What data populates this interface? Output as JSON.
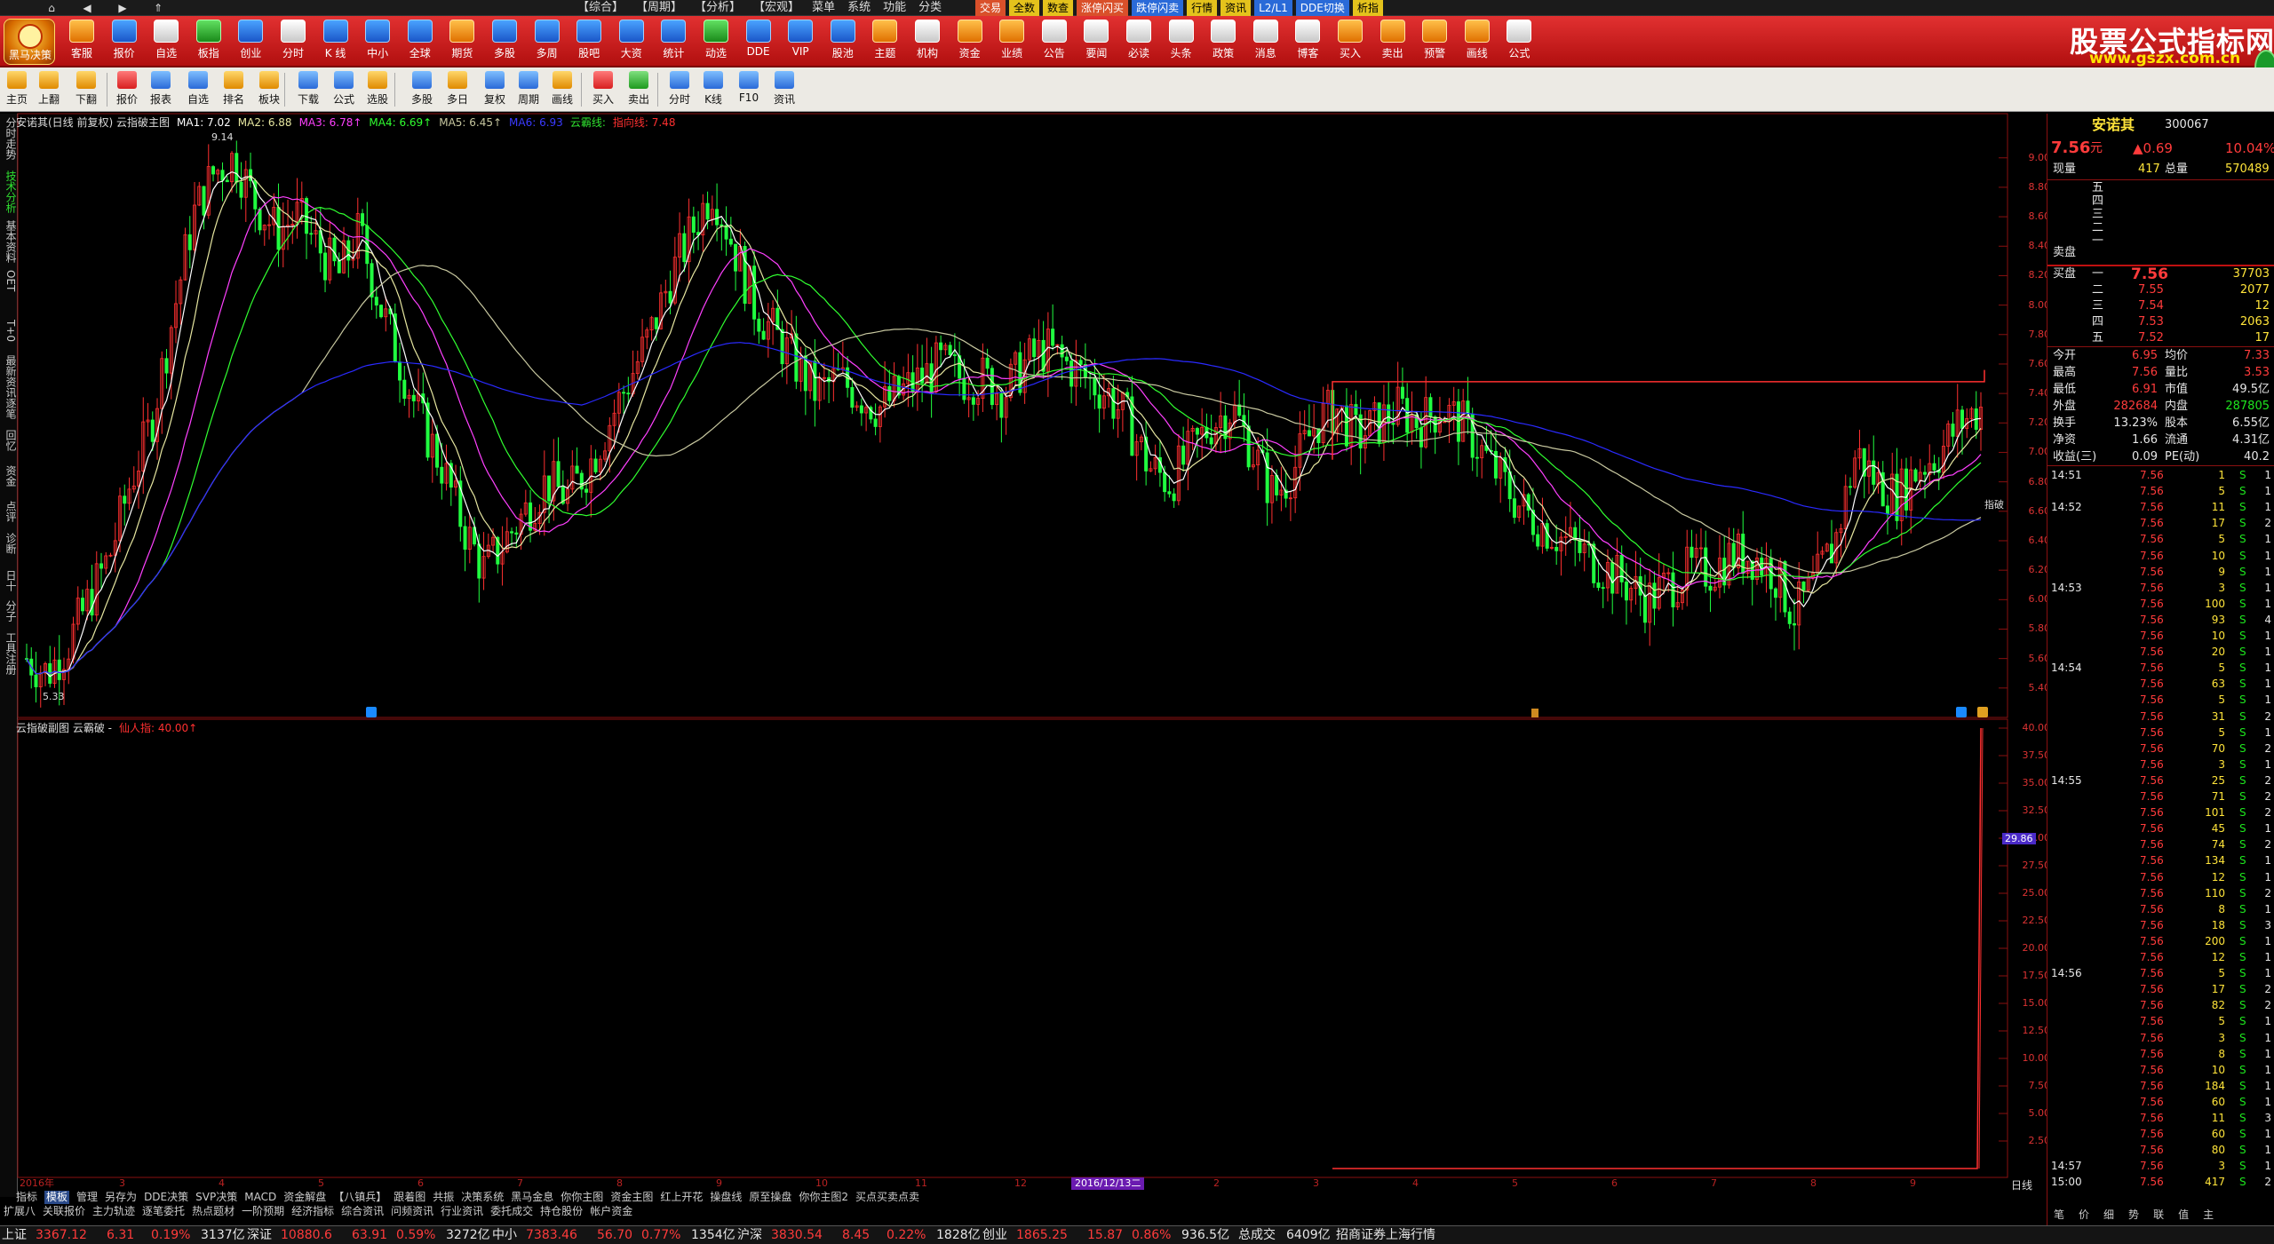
{
  "menubar": {
    "nav": [
      "⌂",
      "◀",
      "▶",
      "⇑"
    ],
    "items": [
      "【综合】",
      "【周期】",
      "【分析】",
      "【宏观】",
      "菜单",
      "系统",
      "功能",
      "分类"
    ],
    "highlight": [
      {
        "label": "交易",
        "bg": "#d9502a",
        "fg": "#ffffff"
      },
      {
        "label": "全数",
        "bg": "#e4c21c",
        "fg": "#000000"
      },
      {
        "label": "数查",
        "bg": "#e4c21c",
        "fg": "#000000"
      },
      {
        "label": "涨停闪买",
        "bg": "#d9502a",
        "fg": "#ffffff"
      },
      {
        "label": "跌停闪卖",
        "bg": "#2a6ad8",
        "fg": "#ffffff"
      },
      {
        "label": "行情",
        "bg": "#e4c21c",
        "fg": "#000000"
      },
      {
        "label": "资讯",
        "bg": "#e4c21c",
        "fg": "#000000"
      },
      {
        "label": "L2/L1",
        "bg": "#2a6ad8",
        "fg": "#ffffff"
      },
      {
        "label": "DDE切换",
        "bg": "#2a6ad8",
        "fg": "#ffffff"
      },
      {
        "label": "析指",
        "bg": "#e4c21c",
        "fg": "#000000"
      }
    ]
  },
  "toolbar1": {
    "logo_label": "黑马决策",
    "items": [
      "客服",
      "报价",
      "自选",
      "板指",
      "创业",
      "分时",
      "K 线",
      "中小",
      "全球",
      "期货",
      "多股",
      "多周",
      "股吧",
      "大资",
      "统计",
      "动选",
      "DDE",
      "VIP",
      "股池",
      "主题",
      "机构",
      "资金",
      "业绩",
      "公告",
      "要闻",
      "必读",
      "头条",
      "政策",
      "消息",
      "博客",
      "买入",
      "卖出",
      "预警",
      "画线",
      "公式"
    ],
    "brand_title": "股票公式指标网",
    "brand_url": "www.gszx.com.cn"
  },
  "toolbar2": {
    "items": [
      "主页",
      "上翻",
      "下翻",
      "报价",
      "报表",
      "自选",
      "排名",
      "板块",
      "下载",
      "公式",
      "选股",
      "多股",
      "多日",
      "复权",
      "周期",
      "画线",
      "买入",
      "卖出",
      "分时",
      "K线",
      "F10",
      "资讯"
    ]
  },
  "left_tabs": [
    "分时走势",
    "技术分析",
    "基本资料",
    "OET",
    "T+0",
    "最新资讯",
    "逐笔",
    "回忆",
    "资金",
    "点评",
    "诊断",
    "日十",
    "分子",
    "工具注册"
  ],
  "chart": {
    "legend_main": [
      {
        "t": "安诺其(日线 前复权) 云指破主图",
        "c": "#dddddd"
      },
      {
        "t": "MA1: 7.02",
        "c": "#ffffff"
      },
      {
        "t": "MA2: 6.88",
        "c": "#e6e6a0"
      },
      {
        "t": "MA3: 6.78↑",
        "c": "#ff40ff"
      },
      {
        "t": "MA4: 6.69↑",
        "c": "#30ff30"
      },
      {
        "t": "MA5: 6.45↑",
        "c": "#c8c8a0"
      },
      {
        "t": "MA6: 6.93",
        "c": "#3a3aff"
      },
      {
        "t": "云霸线:",
        "c": "#30e030"
      },
      {
        "t": "指向线: 7.48",
        "c": "#ff3030"
      }
    ],
    "legend_sub": [
      {
        "t": "云指破副图 云霸破 -",
        "c": "#dddddd"
      },
      {
        "t": "仙人指: 40.00↑",
        "c": "#ff3030"
      }
    ],
    "annot_high": "9.14",
    "annot_low": "5.33",
    "annot_zhipo": "指破",
    "sub_marker": "29.86",
    "date_labels": [
      "2016年",
      "3",
      "4",
      "5",
      "6",
      "7",
      "8",
      "9",
      "10",
      "11",
      "12",
      "2016/12/13二",
      "2",
      "3",
      "4",
      "5",
      "6",
      "7",
      "8",
      "9"
    ],
    "date_hl": "2016/12/13二",
    "colors": {
      "up": "#ff3030",
      "down": "#20ff40",
      "ma1": "#ffffff",
      "ma2": "#e6e6a0",
      "ma3": "#ff40ff",
      "ma4": "#30ff30",
      "ma5": "#c8c8a0",
      "ma6": "#2a2aff",
      "grid": "#3a0a0a"
    }
  },
  "chart_data": {
    "type": "candlestick",
    "title": "安诺其(日线 前复权)",
    "ylim_main": [
      5.2,
      9.3
    ],
    "yticks_main": [
      "9.00",
      "8.80",
      "8.60",
      "8.40",
      "8.20",
      "8.00",
      "7.80",
      "7.60",
      "7.40",
      "7.20",
      "7.00",
      "6.80",
      "6.60",
      "6.40",
      "6.20",
      "6.00",
      "5.80",
      "5.60",
      "5.40"
    ],
    "ylim_sub": [
      0,
      40
    ],
    "yticks_sub": [
      "40.00",
      "37.50",
      "35.00",
      "32.50",
      "30.00",
      "27.50",
      "25.00",
      "22.50",
      "20.00",
      "17.50",
      "15.00",
      "12.50",
      "10.00",
      "7.50",
      "5.00",
      "2.50"
    ],
    "price_path": [
      5.6,
      5.5,
      5.7,
      6.0,
      6.3,
      6.8,
      7.2,
      7.9,
      8.6,
      8.9,
      9.0,
      8.7,
      8.5,
      8.6,
      8.4,
      8.2,
      8.5,
      8.0,
      7.6,
      7.2,
      6.9,
      6.5,
      6.2,
      6.4,
      6.6,
      6.8,
      6.7,
      6.9,
      7.2,
      7.5,
      7.8,
      8.2,
      8.5,
      8.8,
      8.4,
      8.0,
      7.8,
      7.6,
      7.4,
      7.5,
      7.4,
      7.3,
      7.4,
      7.5,
      7.6,
      7.5,
      7.5,
      7.4,
      7.6,
      7.7,
      7.6,
      7.5,
      7.4,
      7.2,
      6.9,
      6.8,
      7.0,
      7.2,
      7.3,
      7.0,
      6.7,
      6.9,
      7.2,
      7.3,
      7.1,
      7.2,
      7.3,
      7.2,
      7.3,
      7.2,
      7.0,
      6.8,
      6.6,
      6.5,
      6.4,
      6.3,
      6.2,
      6.1,
      6.0,
      6.1,
      6.2,
      6.2,
      6.3,
      6.3,
      6.2,
      5.9,
      6.1,
      6.4,
      7.0,
      6.8,
      6.7,
      6.9,
      7.0,
      7.2,
      7.3
    ]
  },
  "quote": {
    "name": "安诺其",
    "code": "300067",
    "price": "7.56",
    "price_unit": "元",
    "change": "▲0.69",
    "pct": "10.04%",
    "xianliang_l": "现量",
    "xianliang_v": "417",
    "zongliang_l": "总量",
    "zongliang_v": "570489",
    "ask_levels": [
      "五",
      "四",
      "三",
      "二",
      "一"
    ],
    "ask_label": "卖盘",
    "bid_label": "买盘",
    "bids": [
      {
        "lvl": "一",
        "p": "7.56",
        "v": "37703"
      },
      {
        "lvl": "二",
        "p": "7.55",
        "v": "2077"
      },
      {
        "lvl": "三",
        "p": "7.54",
        "v": "12"
      },
      {
        "lvl": "四",
        "p": "7.53",
        "v": "2063"
      },
      {
        "lvl": "五",
        "p": "7.52",
        "v": "17"
      }
    ],
    "stats": [
      {
        "l1": "今开",
        "v1": "6.95",
        "c1": "red",
        "l2": "均价",
        "v2": "7.33",
        "c2": "red"
      },
      {
        "l1": "最高",
        "v1": "7.56",
        "c1": "red",
        "l2": "量比",
        "v2": "3.53",
        "c2": "red"
      },
      {
        "l1": "最低",
        "v1": "6.91",
        "c1": "red",
        "l2": "市值",
        "v2": "49.5亿",
        "c2": "wht"
      },
      {
        "l1": "外盘",
        "v1": "282684",
        "c1": "red",
        "l2": "内盘",
        "v2": "287805",
        "c2": "grn"
      },
      {
        "l1": "换手",
        "v1": "13.23%",
        "c1": "wht",
        "l2": "股本",
        "v2": "6.55亿",
        "c2": "wht"
      },
      {
        "l1": "净资",
        "v1": "1.66",
        "c1": "wht",
        "l2": "流通",
        "v2": "4.31亿",
        "c2": "wht"
      },
      {
        "l1": "收益(三)",
        "v1": "0.09",
        "c1": "wht",
        "l2": "PE(动)",
        "v2": "40.2",
        "c2": "wht"
      }
    ]
  },
  "trades": [
    {
      "t": "14:51",
      "p": "7.56",
      "v": "1",
      "bs": "S",
      "n": "1"
    },
    {
      "t": "",
      "p": "7.56",
      "v": "5",
      "bs": "S",
      "n": "1"
    },
    {
      "t": "14:52",
      "p": "7.56",
      "v": "11",
      "bs": "S",
      "n": "1"
    },
    {
      "t": "",
      "p": "7.56",
      "v": "17",
      "bs": "S",
      "n": "2"
    },
    {
      "t": "",
      "p": "7.56",
      "v": "5",
      "bs": "S",
      "n": "1"
    },
    {
      "t": "",
      "p": "7.56",
      "v": "10",
      "bs": "S",
      "n": "1"
    },
    {
      "t": "",
      "p": "7.56",
      "v": "9",
      "bs": "S",
      "n": "1"
    },
    {
      "t": "14:53",
      "p": "7.56",
      "v": "3",
      "bs": "S",
      "n": "1"
    },
    {
      "t": "",
      "p": "7.56",
      "v": "100",
      "bs": "S",
      "n": "1"
    },
    {
      "t": "",
      "p": "7.56",
      "v": "93",
      "bs": "S",
      "n": "4"
    },
    {
      "t": "",
      "p": "7.56",
      "v": "10",
      "bs": "S",
      "n": "1"
    },
    {
      "t": "",
      "p": "7.56",
      "v": "20",
      "bs": "S",
      "n": "1"
    },
    {
      "t": "14:54",
      "p": "7.56",
      "v": "5",
      "bs": "S",
      "n": "1"
    },
    {
      "t": "",
      "p": "7.56",
      "v": "63",
      "bs": "S",
      "n": "1"
    },
    {
      "t": "",
      "p": "7.56",
      "v": "5",
      "bs": "S",
      "n": "1"
    },
    {
      "t": "",
      "p": "7.56",
      "v": "31",
      "bs": "S",
      "n": "2"
    },
    {
      "t": "",
      "p": "7.56",
      "v": "5",
      "bs": "S",
      "n": "1"
    },
    {
      "t": "",
      "p": "7.56",
      "v": "70",
      "bs": "S",
      "n": "2"
    },
    {
      "t": "",
      "p": "7.56",
      "v": "3",
      "bs": "S",
      "n": "1"
    },
    {
      "t": "14:55",
      "p": "7.56",
      "v": "25",
      "bs": "S",
      "n": "2"
    },
    {
      "t": "",
      "p": "7.56",
      "v": "71",
      "bs": "S",
      "n": "2"
    },
    {
      "t": "",
      "p": "7.56",
      "v": "101",
      "bs": "S",
      "n": "2"
    },
    {
      "t": "",
      "p": "7.56",
      "v": "45",
      "bs": "S",
      "n": "1"
    },
    {
      "t": "",
      "p": "7.56",
      "v": "74",
      "bs": "S",
      "n": "2"
    },
    {
      "t": "",
      "p": "7.56",
      "v": "134",
      "bs": "S",
      "n": "1"
    },
    {
      "t": "",
      "p": "7.56",
      "v": "12",
      "bs": "S",
      "n": "1"
    },
    {
      "t": "",
      "p": "7.56",
      "v": "110",
      "bs": "S",
      "n": "2"
    },
    {
      "t": "",
      "p": "7.56",
      "v": "8",
      "bs": "S",
      "n": "1"
    },
    {
      "t": "",
      "p": "7.56",
      "v": "18",
      "bs": "S",
      "n": "3"
    },
    {
      "t": "",
      "p": "7.56",
      "v": "200",
      "bs": "S",
      "n": "1"
    },
    {
      "t": "",
      "p": "7.56",
      "v": "12",
      "bs": "S",
      "n": "1"
    },
    {
      "t": "14:56",
      "p": "7.56",
      "v": "5",
      "bs": "S",
      "n": "1"
    },
    {
      "t": "",
      "p": "7.56",
      "v": "17",
      "bs": "S",
      "n": "2"
    },
    {
      "t": "",
      "p": "7.56",
      "v": "82",
      "bs": "S",
      "n": "2"
    },
    {
      "t": "",
      "p": "7.56",
      "v": "5",
      "bs": "S",
      "n": "1"
    },
    {
      "t": "",
      "p": "7.56",
      "v": "3",
      "bs": "S",
      "n": "1"
    },
    {
      "t": "",
      "p": "7.56",
      "v": "8",
      "bs": "S",
      "n": "1"
    },
    {
      "t": "",
      "p": "7.56",
      "v": "10",
      "bs": "S",
      "n": "1"
    },
    {
      "t": "",
      "p": "7.56",
      "v": "184",
      "bs": "S",
      "n": "1"
    },
    {
      "t": "",
      "p": "7.56",
      "v": "60",
      "bs": "S",
      "n": "1"
    },
    {
      "t": "",
      "p": "7.56",
      "v": "11",
      "bs": "S",
      "n": "3"
    },
    {
      "t": "",
      "p": "7.56",
      "v": "60",
      "bs": "S",
      "n": "1"
    },
    {
      "t": "",
      "p": "7.56",
      "v": "80",
      "bs": "S",
      "n": "1"
    },
    {
      "t": "14:57",
      "p": "7.56",
      "v": "3",
      "bs": "S",
      "n": "1"
    },
    {
      "t": "15:00",
      "p": "7.56",
      "v": "417",
      "bs": "S",
      "n": "2"
    }
  ],
  "bottom": {
    "period_label": "日线",
    "tabs1": [
      "指标",
      "模板",
      "管理",
      "另存为",
      "DDE决策",
      "SVP决策",
      "MACD",
      "资金解盘",
      "【八镇兵】",
      "跟着图",
      "共振",
      "决策系统",
      "黑马金息",
      "你你主图",
      "资金主图",
      "红上开花",
      "操盘线",
      "原至操盘",
      "你你主图2",
      "买点买卖点卖"
    ],
    "tabs2": [
      "扩展八",
      "关联报价",
      "主力轨迹",
      "逐笔委托",
      "热点题材",
      "一阶预期",
      "经济指标",
      "综合资讯",
      "问频资讯",
      "行业资讯",
      "委托成交",
      "持仓股份",
      "帐户资金"
    ],
    "right_foot": [
      "笔",
      "价",
      "细",
      "势",
      "联",
      "值",
      "主"
    ]
  },
  "status": [
    {
      "label": "上证",
      "v1": "3367.12",
      "v2": "6.31",
      "v3": "0.19%",
      "v4": "3137亿"
    },
    {
      "label": "深证",
      "v1": "10880.6",
      "v2": "63.91",
      "v3": "0.59%",
      "v4": "3272亿"
    },
    {
      "label": "中小",
      "v1": "7383.46",
      "v2": "56.70",
      "v3": "0.77%",
      "v4": "1354亿"
    },
    {
      "label": "沪深",
      "v1": "3830.54",
      "v2": "8.45",
      "v3": "0.22%",
      "v4": "1828亿"
    },
    {
      "label": "创业",
      "v1": "1865.25",
      "v2": "15.87",
      "v3": "0.86%",
      "v4": "936.5亿"
    }
  ],
  "status_total_label": "总成交",
  "status_total": "6409亿",
  "status_broker": "招商证券上海行情"
}
